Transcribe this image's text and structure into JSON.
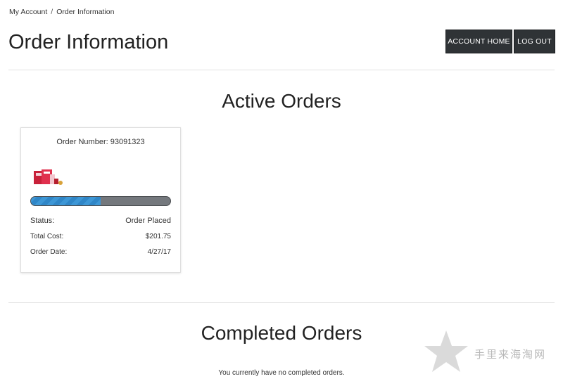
{
  "breadcrumb": {
    "items": [
      "My Account",
      "Order Information"
    ],
    "separator": "/"
  },
  "page_title": "Order Information",
  "header_buttons": {
    "account_home": "ACCOUNT HOME",
    "log_out": "LOG OUT"
  },
  "active_orders": {
    "title": "Active Orders",
    "orders": [
      {
        "order_number_label": "Order Number: 93091323",
        "progress": 0.5,
        "status_label": "Status:",
        "status_value": "Order Placed",
        "total_cost_label": "Total Cost:",
        "total_cost_value": "$201.75",
        "order_date_label": "Order Date:",
        "order_date_value": "4/27/17"
      }
    ]
  },
  "completed_orders": {
    "title": "Completed Orders",
    "empty_message": "You currently have no completed orders."
  },
  "watermark_text": "手里来海淘网",
  "colors": {
    "button_bg": "#2f3336",
    "progress_fill": "#3d97d6",
    "progress_track": "#74787d"
  }
}
